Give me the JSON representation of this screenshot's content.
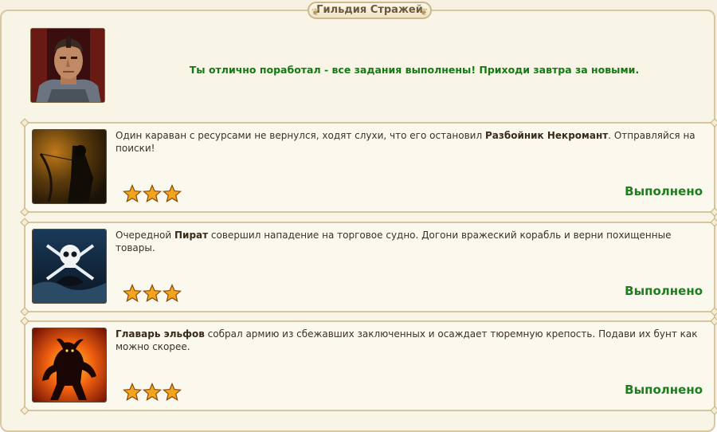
{
  "header": {
    "title": "Гильдия Стражей"
  },
  "guard": {
    "message": "Ты отлично поработал - все задания выполнены! Приходи завтра за новыми."
  },
  "quests": [
    {
      "text_before": "Один караван с ресурсами не вернулся, ходят слухи, что его остановил ",
      "bold": "Разбойник Некромант",
      "text_after": ". Отправляйся на поиски!",
      "stars": 3,
      "status": "Выполнено",
      "image_icon": "necromancer-bandit-icon"
    },
    {
      "text_before": "Очередной ",
      "bold": "Пират",
      "text_after": " совершил нападение на торговое судно. Догони вражеский корабль и верни похищенные товары.",
      "stars": 3,
      "status": "Выполнено",
      "image_icon": "pirate-skull-icon"
    },
    {
      "text_before": "",
      "bold": "Главарь эльфов",
      "text_after": " собрал армию из сбежавших заключенных и осаждает тюремную крепость. Подави их бунт как можно скорее.",
      "stars": 3,
      "status": "Выполнено",
      "image_icon": "fire-demon-icon"
    }
  ],
  "colors": {
    "message": "#137a13",
    "status": "#1e7d1e",
    "panel_border": "#d6c6a0",
    "background": "#f8f4e6"
  }
}
